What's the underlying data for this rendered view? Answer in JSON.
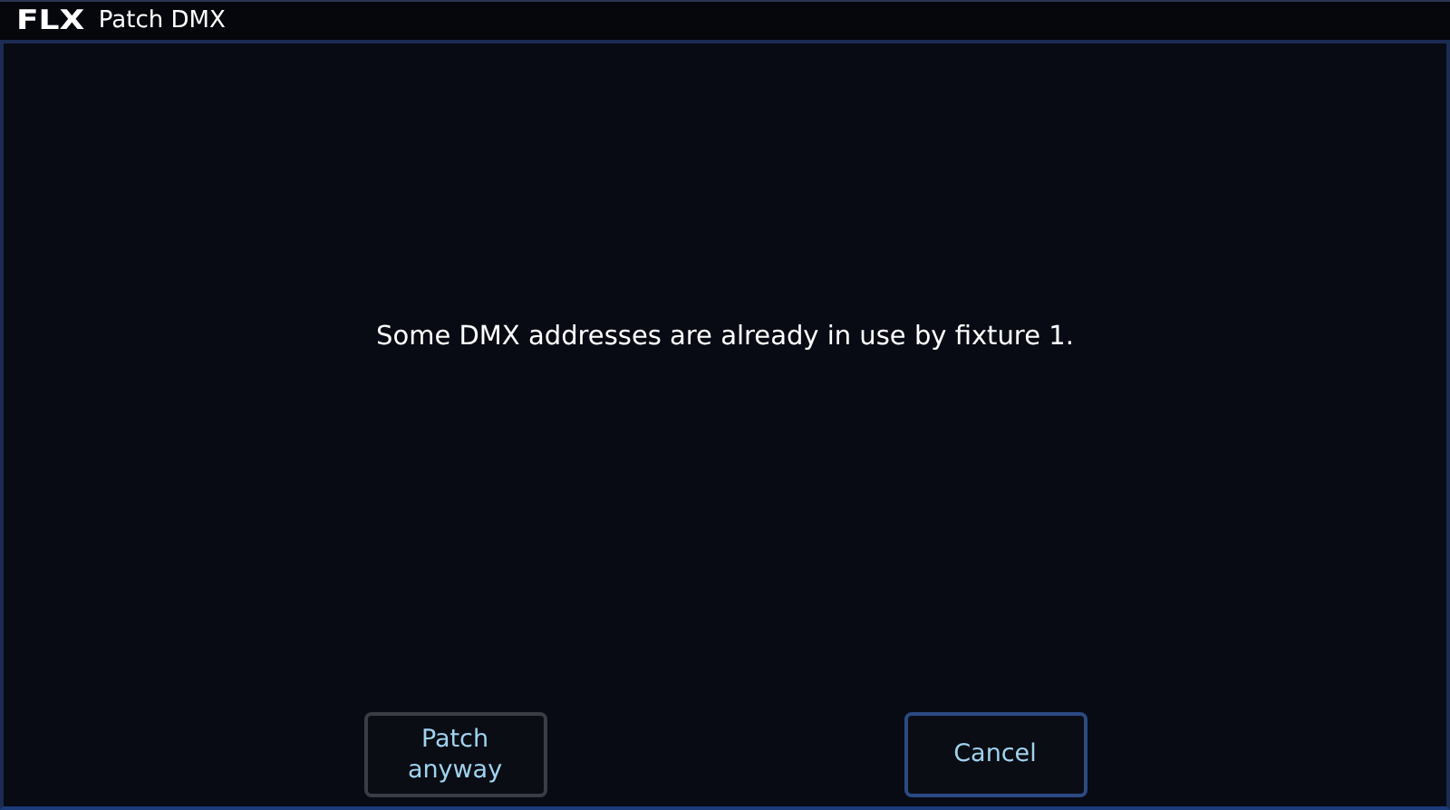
{
  "window": {
    "logo": "FLX",
    "title": "Patch DMX"
  },
  "message": "Some DMX addresses are already in use by fixture 1.",
  "buttons": [
    {
      "label": "Patch\nanyway",
      "focused": false
    },
    {
      "label": "Cancel",
      "focused": true
    }
  ]
}
